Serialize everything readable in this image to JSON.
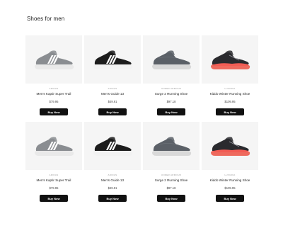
{
  "page": {
    "title": "Shoes for men"
  },
  "products": [
    {
      "brand": "ADIDAS",
      "name": "Men's Kaptir Super Trail",
      "price": "$79.95",
      "cta": "Buy Now",
      "image": "grey-adidas-sneaker",
      "colors": {
        "body": "#8a8d91",
        "accent": "#ffffff",
        "sole": "#e9e9e9"
      }
    },
    {
      "brand": "ADIDAS",
      "name": "Men's Guide 13",
      "price": "$49.91",
      "cta": "Buy Now",
      "image": "black-adidas-sneaker",
      "colors": {
        "body": "#1c1c1c",
        "accent": "#ffffff",
        "sole": "#f2f2f2"
      }
    },
    {
      "brand": "UNDER ARMOUR",
      "name": "Surge 2 Running Shoe",
      "price": "$97.18",
      "cta": "Buy Now",
      "image": "grey-slip-on-shoe",
      "colors": {
        "body": "#5b6067",
        "accent": "#6b7077",
        "sole": "#d9d9d9"
      }
    },
    {
      "brand": "LUXURIA",
      "name": "Kiddo Winter Running Shoe",
      "price": "$109.95",
      "cta": "Buy Now",
      "image": "black-red-running-shoe",
      "colors": {
        "body": "#2a2a2e",
        "accent": "#f25c54",
        "sole": "#ee6a5e"
      }
    },
    {
      "brand": "ADIDAS",
      "name": "Men's Kaptir Super Trail",
      "price": "$79.95",
      "cta": "Buy Now",
      "image": "grey-adidas-sneaker",
      "colors": {
        "body": "#8a8d91",
        "accent": "#ffffff",
        "sole": "#e9e9e9"
      }
    },
    {
      "brand": "ADIDAS",
      "name": "Men's Guide 13",
      "price": "$49.91",
      "cta": "Buy Now",
      "image": "black-adidas-sneaker",
      "colors": {
        "body": "#1c1c1c",
        "accent": "#ffffff",
        "sole": "#f2f2f2"
      }
    },
    {
      "brand": "UNDER ARMOUR",
      "name": "Surge 2 Running Shoe",
      "price": "$97.18",
      "cta": "Buy Now",
      "image": "grey-slip-on-shoe",
      "colors": {
        "body": "#5b6067",
        "accent": "#6b7077",
        "sole": "#d9d9d9"
      }
    },
    {
      "brand": "LUXURIA",
      "name": "Kiddo Winter Running Shoe",
      "price": "$109.95",
      "cta": "Buy Now",
      "image": "black-red-running-shoe",
      "colors": {
        "body": "#2a2a2e",
        "accent": "#f25c54",
        "sole": "#ee6a5e"
      }
    }
  ]
}
